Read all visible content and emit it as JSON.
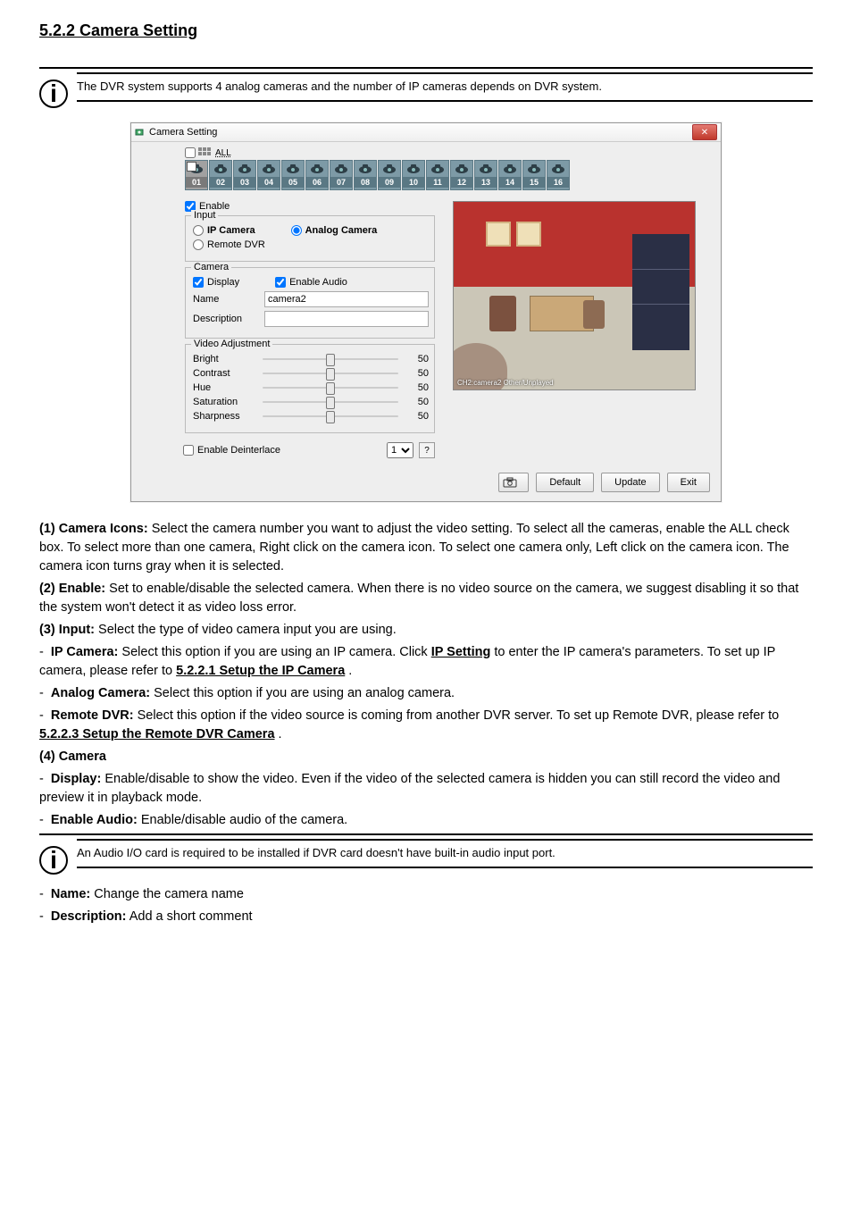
{
  "heading": "5.2.2 Camera Setting",
  "info_top": "The DVR system supports 4 analog cameras and the number of IP cameras depends on DVR system.",
  "dialog": {
    "title": "Camera Setting",
    "close_glyph": "✕",
    "all_label": "ALL",
    "cam_numbers": [
      "01",
      "02",
      "03",
      "04",
      "05",
      "06",
      "07",
      "08",
      "09",
      "10",
      "11",
      "12",
      "13",
      "14",
      "15",
      "16"
    ],
    "selected_index": 0,
    "enable_label": "Enable",
    "input": {
      "legend": "Input",
      "ip": "IP Camera",
      "analog": "Analog Camera",
      "remote": "Remote DVR"
    },
    "camera": {
      "legend": "Camera",
      "display": "Display",
      "enable_audio": "Enable Audio",
      "name_label": "Name",
      "name_value": "camera2",
      "desc_label": "Description",
      "desc_value": ""
    },
    "adjust": {
      "legend": "Video Adjustment",
      "bright_label": "Bright",
      "contrast_label": "Contrast",
      "hue_label": "Hue",
      "saturation_label": "Saturation",
      "sharpness_label": "Sharpness",
      "bright": "50",
      "contrast": "50",
      "hue": "50",
      "saturation": "50",
      "sharpness": "50"
    },
    "deinterlace_label": "Enable Deinterlace",
    "deinterlace_value": "1",
    "help_glyph": "?",
    "preview_overlay": "CH2:camera2  Other/Unplayed",
    "footer": {
      "snapshot_glyph": "⎙",
      "default": "Default",
      "update": "Update",
      "exit": "Exit"
    }
  },
  "body": {
    "p1_label": "(1) Camera Icons:",
    "p1_text": " Select the camera number you want to adjust the video setting. To select all the cameras, enable the ALL check box. To select more than one camera, Right click on the camera icon. To select one camera only, Left click on the camera icon. The camera icon turns gray when it is selected.",
    "p2_label": "(2) Enable:",
    "p2_text": " Set to enable/disable the selected camera. When there is no video source on the camera, we suggest disabling it so that the system won't detect it as video loss error.",
    "p3_label": "(3) Input:",
    "p3_text": " Select the type of video camera input you are using.",
    "p3_sub_label": "IP Camera:",
    "p3_sub_text_a": " Select this option if you are using an IP camera. Click ",
    "p3_sub_link": "IP Setting",
    "p3_sub_text_b": " to enter the IP camera's parameters. To set up IP camera, please refer to ",
    "p3_sub_ref": "5.2.2.1 Setup the IP Camera",
    "p3_sub_text_c": ".",
    "p3_sub2_label": "Analog Camera:",
    "p3_sub2_text": " Select this option if you are using an analog camera.",
    "p3_sub3_label": "Remote DVR:",
    "p3_sub3_text": " Select this option if the video source is coming from another DVR server. To set up Remote DVR, please refer to ",
    "p3_sub3_ref": "5.2.2.3 Setup the Remote DVR Camera",
    "p3_sub3_text_c": ".",
    "p4_label": "(4) Camera",
    "p4_display_label": "Display:",
    "p4_display_text": " Enable/disable to show the video. Even if the video of the selected camera is hidden you can still record the video and preview it in playback mode.",
    "p4_audio_label": "Enable Audio:",
    "p4_audio_text": " Enable/disable audio of the camera.",
    "info_bottom": "An Audio I/O card is required to be installed if DVR card doesn't have built-in audio input port.",
    "p4_name_label": "Name:",
    "p4_name_text": " Change the camera name",
    "p4_desc_label": "Description:",
    "p4_desc_text": " Add a short comment"
  }
}
